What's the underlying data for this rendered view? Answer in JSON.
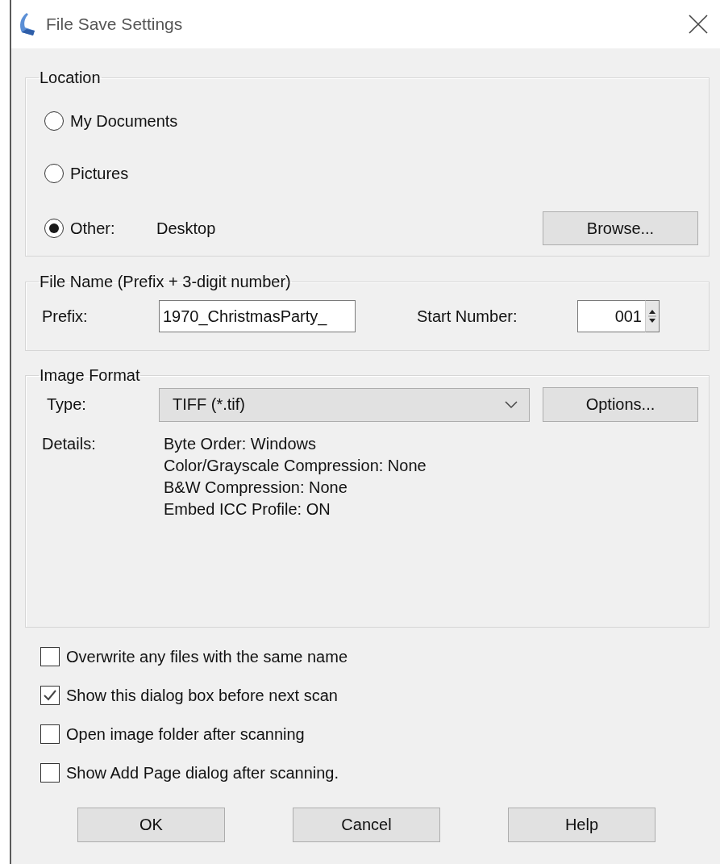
{
  "window": {
    "title": "File Save Settings"
  },
  "location": {
    "title": "Location",
    "options": [
      {
        "label": "My Documents",
        "selected": false
      },
      {
        "label": "Pictures",
        "selected": false
      },
      {
        "label": "Other:",
        "selected": true,
        "value": "Desktop"
      }
    ],
    "browse_button": "Browse..."
  },
  "file_name": {
    "title": "File Name (Prefix + 3-digit number)",
    "prefix_label": "Prefix:",
    "prefix": "1970_ChristmasParty_",
    "start_number_label": "Start Number:",
    "start_number": "001"
  },
  "image_format": {
    "title": "Image Format",
    "type_label": "Type:",
    "type": "TIFF (*.tif)",
    "options_button": "Options...",
    "details_label": "Details:",
    "details": [
      "Byte Order: Windows",
      "Color/Grayscale Compression: None",
      "B&W Compression: None",
      "Embed ICC Profile: ON"
    ]
  },
  "checkboxes": [
    {
      "label": "Overwrite any files with the same name",
      "checked": false
    },
    {
      "label": "Show this dialog box before next scan",
      "checked": true
    },
    {
      "label": "Open image folder after scanning",
      "checked": false
    },
    {
      "label": "Show Add Page dialog after scanning.",
      "checked": false
    }
  ],
  "buttons": [
    "OK",
    "Cancel",
    "Help"
  ]
}
